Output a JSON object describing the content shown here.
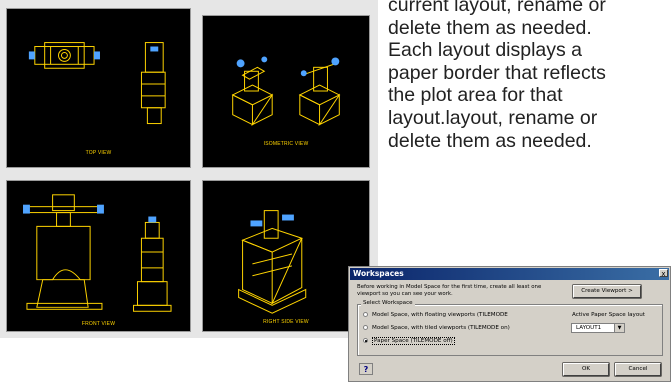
{
  "paragraph": {
    "lines": [
      "current layout, rename or",
      "delete them as needed.",
      "Each layout displays a",
      "paper border that reflects",
      "the plot area for that",
      "layout.layout, rename or",
      "delete them as needed."
    ]
  },
  "viewports": {
    "top_view": "TOP VIEW",
    "isometric_view": "ISOMETRIC VIEW",
    "front_view": "FRONT VIEW",
    "right_side_view": "RIGHT SIDE VIEW"
  },
  "dialog": {
    "title": "Workspaces",
    "close_glyph": "x",
    "intro": "Before working in Model Space for the first time, create all least one viewport so you can see your work.",
    "create_viewport_label": "Create Viewport >",
    "group_label": "Select Workspace",
    "options": [
      "Model Space, with floating viewports (TILEMODE",
      "Model Space, with tiled viewports (TILEMODE on)",
      "Paper Space (TILEMODE off)"
    ],
    "selected_option_index": 2,
    "active_layout_label": "Active Paper Space layout",
    "active_layout_value": "LAYOUT1",
    "ok_label": "OK",
    "cancel_label": "Cancel",
    "title_bar_colors": [
      "#0a246a",
      "#3a6ea5"
    ],
    "drawing_color": "#ffd400",
    "accent_color": "#4fa3ff"
  }
}
